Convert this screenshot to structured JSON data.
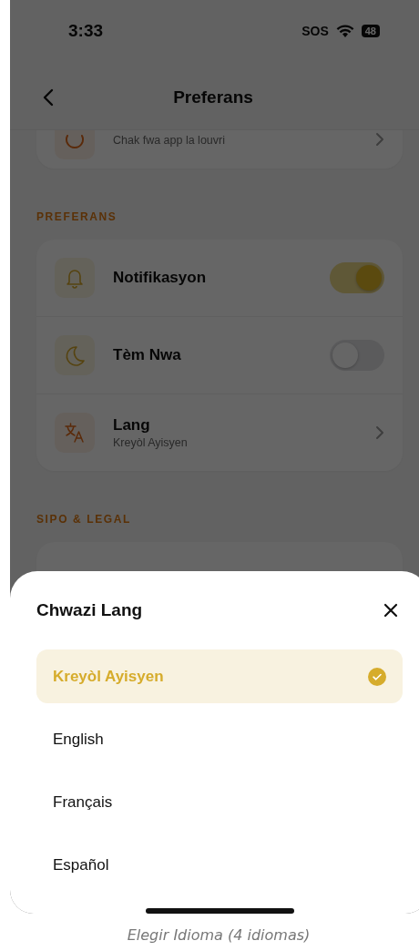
{
  "status_bar": {
    "time": "3:33",
    "carrier": "SOS",
    "battery": "48"
  },
  "header": {
    "title": "Preferans"
  },
  "top_card": {
    "subtitle": "Chak fwa app la louvri"
  },
  "sections": [
    {
      "title": "PREFERANS",
      "rows": [
        {
          "kind": "toggle",
          "label": "Notifikasyon",
          "on": true
        },
        {
          "kind": "toggle",
          "label": "Tèm Nwa",
          "on": false
        },
        {
          "kind": "link",
          "label": "Lang",
          "subtitle": "Kreyòl Ayisyen"
        }
      ]
    },
    {
      "title": "SIPO & LEGAL"
    }
  ],
  "sheet": {
    "title": "Chwazi Lang",
    "options": [
      {
        "label": "Kreyòl Ayisyen",
        "selected": true
      },
      {
        "label": "English",
        "selected": false
      },
      {
        "label": "Français",
        "selected": false
      },
      {
        "label": "Español",
        "selected": false
      }
    ]
  },
  "caption": "Elegir Idioma (4 idiomas)"
}
